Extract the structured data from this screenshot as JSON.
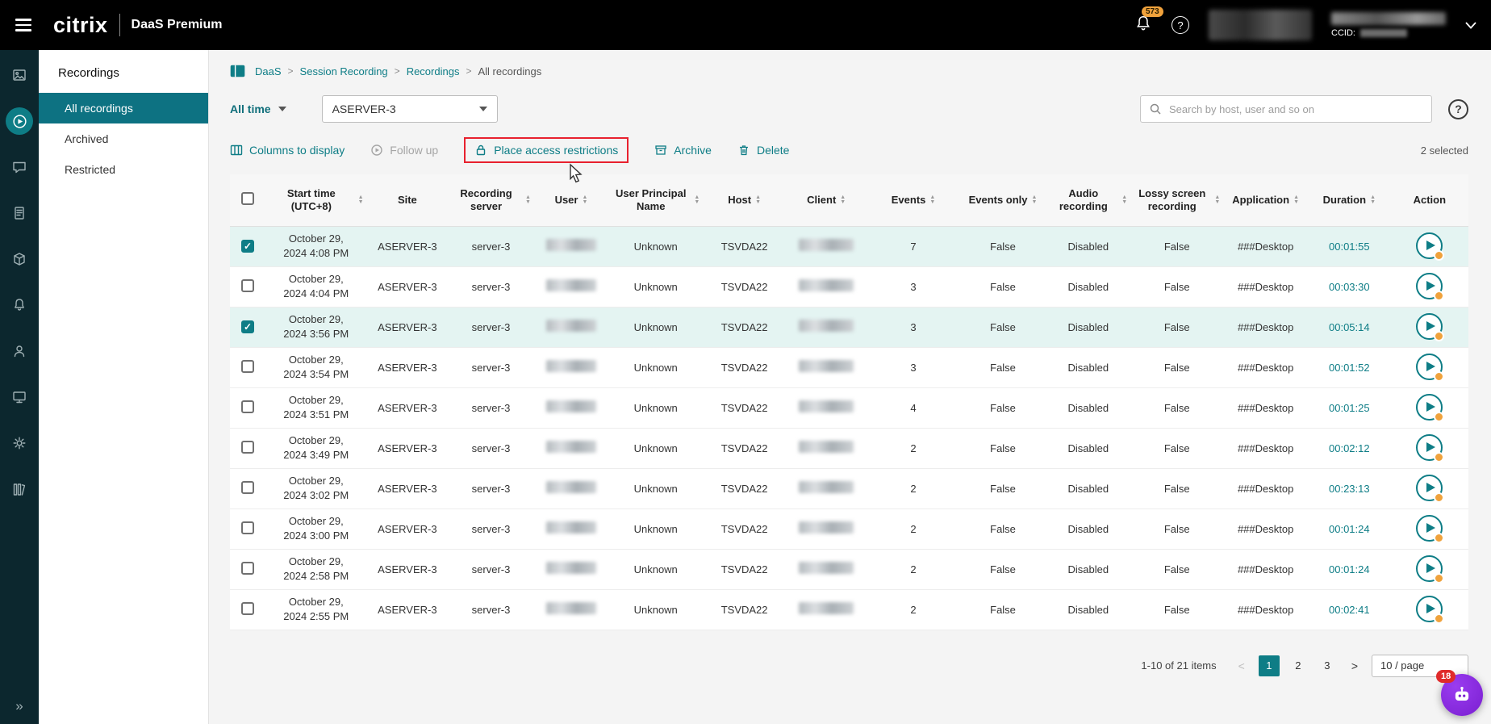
{
  "topbar": {
    "brand": "citrix",
    "product": "DaaS Premium",
    "notification_badge": "573",
    "help_glyph": "?",
    "ccid_label": "CCID:"
  },
  "rail": {
    "icons": [
      "dashboard-icon",
      "session-recordings-icon",
      "messages-icon",
      "journal-icon",
      "packages-icon",
      "alerts-icon",
      "identity-icon",
      "devices-icon",
      "settings-icon",
      "library-icon"
    ],
    "selected_icon": "session-recordings-icon",
    "expand_glyph": "»"
  },
  "sidebar": {
    "title": "Recordings",
    "items": [
      {
        "label": "All recordings",
        "selected": true
      },
      {
        "label": "Archived",
        "selected": false
      },
      {
        "label": "Restricted",
        "selected": false
      }
    ]
  },
  "breadcrumb": {
    "items": [
      "DaaS",
      "Session Recording",
      "Recordings",
      "All recordings"
    ]
  },
  "filters": {
    "time_range": "All time",
    "server": "ASERVER-3",
    "search_placeholder": "Search by host, user and so on"
  },
  "toolbar": {
    "columns_label": "Columns to display",
    "follow_up_label": "Follow up",
    "restrict_label": "Place access restrictions",
    "archive_label": "Archive",
    "delete_label": "Delete",
    "selected_count": "2 selected"
  },
  "table": {
    "columns": [
      {
        "label": "Start time (UTC+8)",
        "field": "start_time",
        "sortable": true
      },
      {
        "label": "Site",
        "field": "site",
        "sortable": false
      },
      {
        "label": "Recording server",
        "field": "recording_server",
        "sortable": true
      },
      {
        "label": "User",
        "field": "user",
        "sortable": true,
        "blurred": true
      },
      {
        "label": "User Principal Name",
        "field": "user_principal_name",
        "sortable": true
      },
      {
        "label": "Host",
        "field": "host",
        "sortable": true
      },
      {
        "label": "Client",
        "field": "client",
        "sortable": true,
        "blurred": true
      },
      {
        "label": "Events",
        "field": "events",
        "sortable": true
      },
      {
        "label": "Events only",
        "field": "events_only",
        "sortable": true
      },
      {
        "label": "Audio recording",
        "field": "audio_recording",
        "sortable": true
      },
      {
        "label": "Lossy screen recording",
        "field": "lossy_screen_recording",
        "sortable": true
      },
      {
        "label": "Application",
        "field": "application",
        "sortable": true
      },
      {
        "label": "Duration",
        "field": "duration",
        "sortable": true
      },
      {
        "label": "Action",
        "field": "action",
        "sortable": false
      }
    ],
    "rows": [
      {
        "selected": true,
        "start_time": "October 29, 2024 4:08 PM",
        "site": "ASERVER-3",
        "recording_server": "server-3",
        "user": "",
        "user_principal_name": "Unknown",
        "host": "TSVDA22",
        "client": "",
        "events": "7",
        "events_only": "False",
        "audio_recording": "Disabled",
        "lossy_screen_recording": "False",
        "application": "###Desktop",
        "duration": "00:01:55"
      },
      {
        "selected": false,
        "start_time": "October 29, 2024 4:04 PM",
        "site": "ASERVER-3",
        "recording_server": "server-3",
        "user": "",
        "user_principal_name": "Unknown",
        "host": "TSVDA22",
        "client": "",
        "events": "3",
        "events_only": "False",
        "audio_recording": "Disabled",
        "lossy_screen_recording": "False",
        "application": "###Desktop",
        "duration": "00:03:30"
      },
      {
        "selected": true,
        "start_time": "October 29, 2024 3:56 PM",
        "site": "ASERVER-3",
        "recording_server": "server-3",
        "user": "",
        "user_principal_name": "Unknown",
        "host": "TSVDA22",
        "client": "",
        "events": "3",
        "events_only": "False",
        "audio_recording": "Disabled",
        "lossy_screen_recording": "False",
        "application": "###Desktop",
        "duration": "00:05:14"
      },
      {
        "selected": false,
        "start_time": "October 29, 2024 3:54 PM",
        "site": "ASERVER-3",
        "recording_server": "server-3",
        "user": "",
        "user_principal_name": "Unknown",
        "host": "TSVDA22",
        "client": "",
        "events": "3",
        "events_only": "False",
        "audio_recording": "Disabled",
        "lossy_screen_recording": "False",
        "application": "###Desktop",
        "duration": "00:01:52"
      },
      {
        "selected": false,
        "start_time": "October 29, 2024 3:51 PM",
        "site": "ASERVER-3",
        "recording_server": "server-3",
        "user": "",
        "user_principal_name": "Unknown",
        "host": "TSVDA22",
        "client": "",
        "events": "4",
        "events_only": "False",
        "audio_recording": "Disabled",
        "lossy_screen_recording": "False",
        "application": "###Desktop",
        "duration": "00:01:25"
      },
      {
        "selected": false,
        "start_time": "October 29, 2024 3:49 PM",
        "site": "ASERVER-3",
        "recording_server": "server-3",
        "user": "",
        "user_principal_name": "Unknown",
        "host": "TSVDA22",
        "client": "",
        "events": "2",
        "events_only": "False",
        "audio_recording": "Disabled",
        "lossy_screen_recording": "False",
        "application": "###Desktop",
        "duration": "00:02:12"
      },
      {
        "selected": false,
        "start_time": "October 29, 2024 3:02 PM",
        "site": "ASERVER-3",
        "recording_server": "server-3",
        "user": "",
        "user_principal_name": "Unknown",
        "host": "TSVDA22",
        "client": "",
        "events": "2",
        "events_only": "False",
        "audio_recording": "Disabled",
        "lossy_screen_recording": "False",
        "application": "###Desktop",
        "duration": "00:23:13"
      },
      {
        "selected": false,
        "start_time": "October 29, 2024 3:00 PM",
        "site": "ASERVER-3",
        "recording_server": "server-3",
        "user": "",
        "user_principal_name": "Unknown",
        "host": "TSVDA22",
        "client": "",
        "events": "2",
        "events_only": "False",
        "audio_recording": "Disabled",
        "lossy_screen_recording": "False",
        "application": "###Desktop",
        "duration": "00:01:24"
      },
      {
        "selected": false,
        "start_time": "October 29, 2024 2:58 PM",
        "site": "ASERVER-3",
        "recording_server": "server-3",
        "user": "",
        "user_principal_name": "Unknown",
        "host": "TSVDA22",
        "client": "",
        "events": "2",
        "events_only": "False",
        "audio_recording": "Disabled",
        "lossy_screen_recording": "False",
        "application": "###Desktop",
        "duration": "00:01:24"
      },
      {
        "selected": false,
        "start_time": "October 29, 2024 2:55 PM",
        "site": "ASERVER-3",
        "recording_server": "server-3",
        "user": "",
        "user_principal_name": "Unknown",
        "host": "TSVDA22",
        "client": "",
        "events": "2",
        "events_only": "False",
        "audio_recording": "Disabled",
        "lossy_screen_recording": "False",
        "application": "###Desktop",
        "duration": "00:02:41"
      }
    ]
  },
  "pagination": {
    "summary": "1-10 of 21 items",
    "pages": [
      "1",
      "2",
      "3"
    ],
    "active_page": "1",
    "page_size": "10 / page"
  },
  "assistant": {
    "badge": "18"
  },
  "glyphs": {
    "help": "?",
    "prev": "<",
    "next": ">"
  },
  "colors": {
    "accent_teal": "#0e7d86",
    "selected_row": "#e4f4f2",
    "annotation_red": "#e8212e",
    "badge_orange": "#f0a23c",
    "assistant_purple": "#7a1fd0",
    "badge_red": "#e02b2b"
  }
}
